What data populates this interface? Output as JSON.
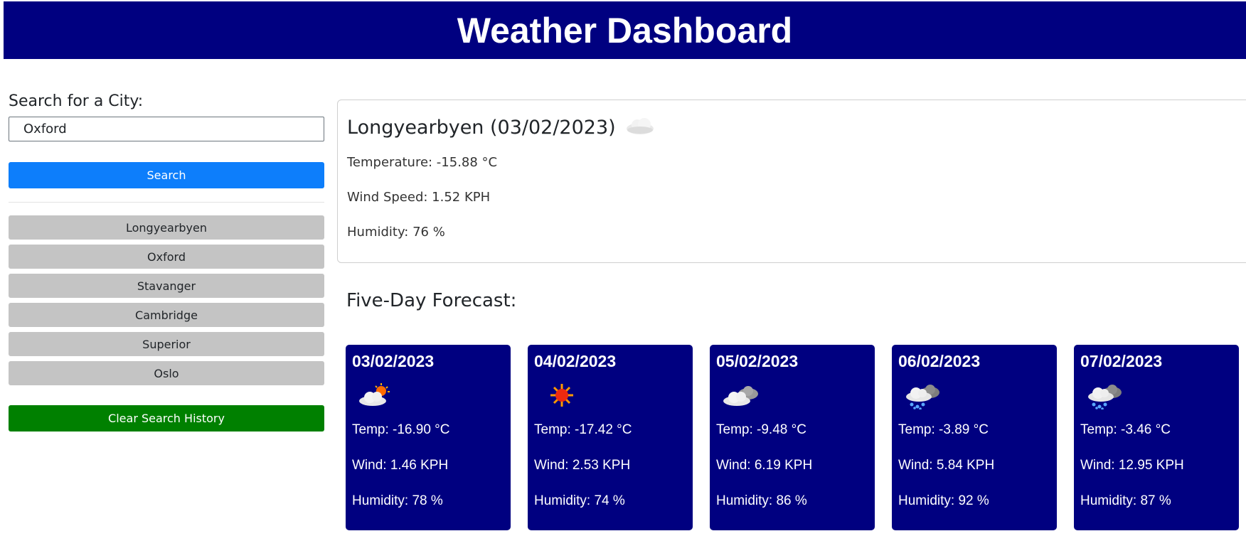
{
  "header": {
    "title": "Weather Dashboard"
  },
  "search": {
    "label": "Search for a City:",
    "value": "Oxford",
    "button_label": "Search"
  },
  "history": [
    "Longyearbyen",
    "Oxford",
    "Stavanger",
    "Cambridge",
    "Superior",
    "Oslo"
  ],
  "clear_label": "Clear Search History",
  "current": {
    "title": "Longyearbyen (03/02/2023)",
    "icon": "cloud-icon",
    "temperature": "Temperature: -15.88 °C",
    "wind": "Wind Speed: 1.52 KPH",
    "humidity": "Humidity: 76 %"
  },
  "forecast_title": "Five-Day Forecast:",
  "forecast": [
    {
      "date": "03/02/2023",
      "icon": "partly-cloudy-icon",
      "temp": "Temp: -16.90 °C",
      "wind": "Wind: 1.46 KPH",
      "humidity": "Humidity: 78 %"
    },
    {
      "date": "04/02/2023",
      "icon": "sun-icon",
      "temp": "Temp: -17.42 °C",
      "wind": "Wind: 2.53 KPH",
      "humidity": "Humidity: 74 %"
    },
    {
      "date": "05/02/2023",
      "icon": "cloudy-icon",
      "temp": "Temp: -9.48 °C",
      "wind": "Wind: 6.19 KPH",
      "humidity": "Humidity: 86 %"
    },
    {
      "date": "06/02/2023",
      "icon": "snow-icon",
      "temp": "Temp: -3.89 °C",
      "wind": "Wind: 5.84 KPH",
      "humidity": "Humidity: 92 %"
    },
    {
      "date": "07/02/2023",
      "icon": "snow-icon",
      "temp": "Temp: -3.46 °C",
      "wind": "Wind: 12.95 KPH",
      "humidity": "Humidity: 87 %"
    }
  ],
  "colors": {
    "header": "#000080",
    "search": "#0d7efb",
    "clear": "#008000",
    "history": "#c4c4c4",
    "card": "#000080"
  }
}
